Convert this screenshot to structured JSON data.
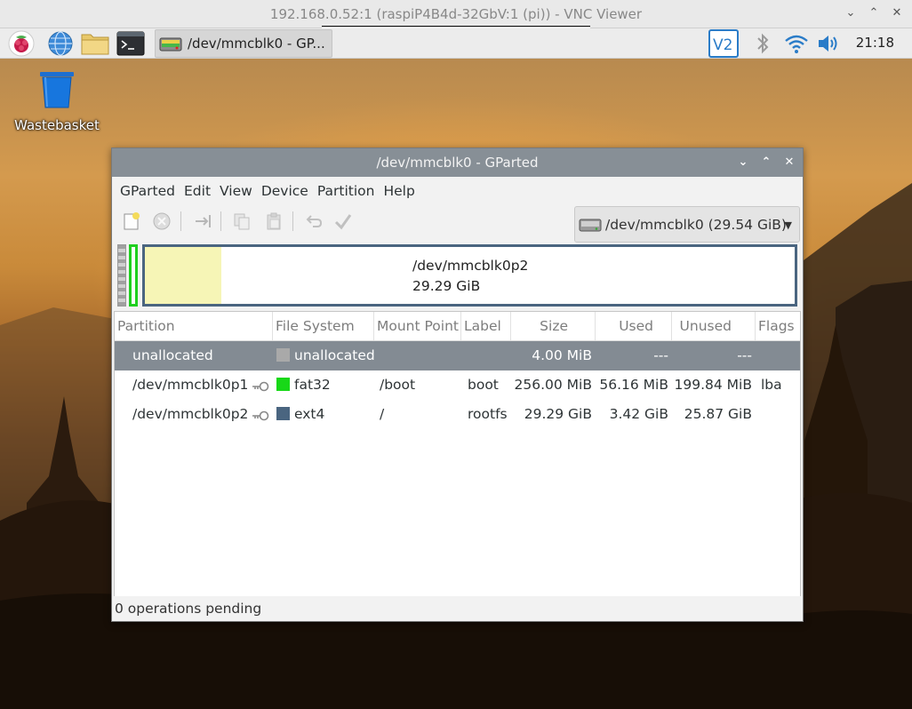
{
  "vnc": {
    "title": "192.168.0.52:1 (raspiP4B4d-32GbV:1 (pi)) - VNC Viewer"
  },
  "taskbar": {
    "icons": [
      "raspberry-menu-icon",
      "web-browser-icon",
      "file-manager-icon",
      "terminal-icon",
      "vnc-server-icon",
      "bluetooth-icon",
      "wifi-icon",
      "volume-icon"
    ],
    "active_task": "/dev/mmcblk0 - GP...",
    "clock": "21:18"
  },
  "desktop": {
    "wastebasket_label": "Wastebasket"
  },
  "window": {
    "title": "/dev/mmcblk0 - GParted",
    "menu": [
      "GParted",
      "Edit",
      "View",
      "Device",
      "Partition",
      "Help"
    ],
    "device_selector": "/dev/mmcblk0  (29.54 GiB)",
    "partition_graph": {
      "label": "/dev/mmcblk0p2",
      "size": "29.29 GiB",
      "used_fraction": 0.117
    },
    "columns": [
      "Partition",
      "File System",
      "Mount Point",
      "Label",
      "Size",
      "Used",
      "Unused",
      "Flags"
    ],
    "rows": [
      {
        "partition": "unallocated",
        "fs": "unallocated",
        "fs_color": "#a9a9a9",
        "mount": "",
        "label": "",
        "size": "4.00 MiB",
        "used": "---",
        "unused": "---",
        "flags": "",
        "key": false
      },
      {
        "partition": "/dev/mmcblk0p1",
        "fs": "fat32",
        "fs_color": "#18d818",
        "mount": "/boot",
        "label": "boot",
        "size": "256.00 MiB",
        "used": "56.16 MiB",
        "unused": "199.84 MiB",
        "flags": "lba",
        "key": true
      },
      {
        "partition": "/dev/mmcblk0p2",
        "fs": "ext4",
        "fs_color": "#4a6580",
        "mount": "/",
        "label": "rootfs",
        "size": "29.29 GiB",
        "used": "3.42 GiB",
        "unused": "25.87 GiB",
        "flags": "",
        "key": true
      }
    ],
    "status": "0 operations pending"
  }
}
